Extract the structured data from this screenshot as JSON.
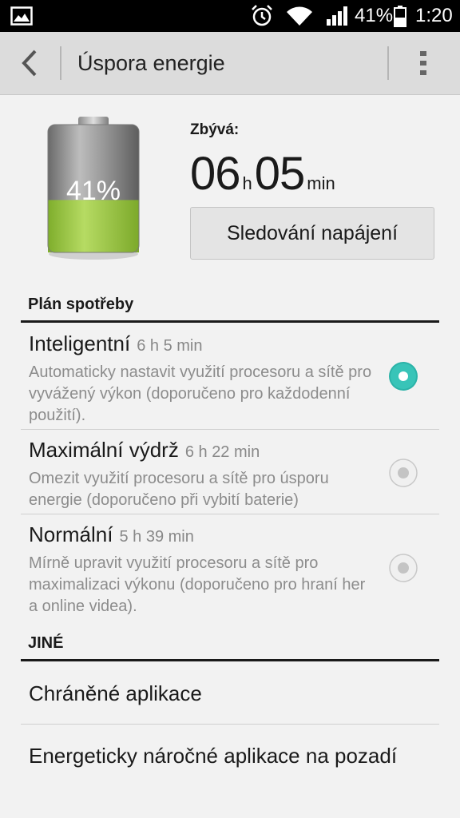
{
  "status_bar": {
    "battery_percent": "41%",
    "time": "1:20",
    "icons": [
      "image-icon",
      "alarm-icon",
      "wifi-icon",
      "signal-icon",
      "battery-icon"
    ]
  },
  "action_bar": {
    "title": "Úspora energie",
    "icons": [
      "back-icon",
      "more-vert-icon"
    ]
  },
  "battery": {
    "level_percent": 41,
    "label": "41%",
    "remaining_label": "Zbývá:",
    "hours": "06",
    "hours_unit": "h",
    "minutes": "05",
    "minutes_unit": "min",
    "track_button": "Sledování napájení",
    "fill_color": "#97c63f"
  },
  "plan": {
    "header": "Plán spotřeby",
    "items": [
      {
        "title": "Inteligentní",
        "time": "6 h 5 min",
        "desc": "Automaticky nastavit využití procesoru a sítě pro vyvážený výkon (doporučeno pro každodenní použití).",
        "selected": true
      },
      {
        "title": "Maximální výdrž",
        "time": "6 h 22 min",
        "desc": "Omezit využití procesoru a sítě pro úsporu energie (doporučeno při vybití baterie)",
        "selected": false
      },
      {
        "title": "Normální",
        "time": "5 h 39 min",
        "desc": "Mírně upravit využití procesoru a sítě pro maximalizaci výkonu (doporučeno pro hraní her a online videa).",
        "selected": false
      }
    ],
    "accent_color": "#2bb3a8"
  },
  "other": {
    "header": "JINÉ",
    "items": [
      {
        "label": "Chráněné aplikace"
      },
      {
        "label": "Energeticky náročné aplikace na pozadí"
      }
    ]
  }
}
